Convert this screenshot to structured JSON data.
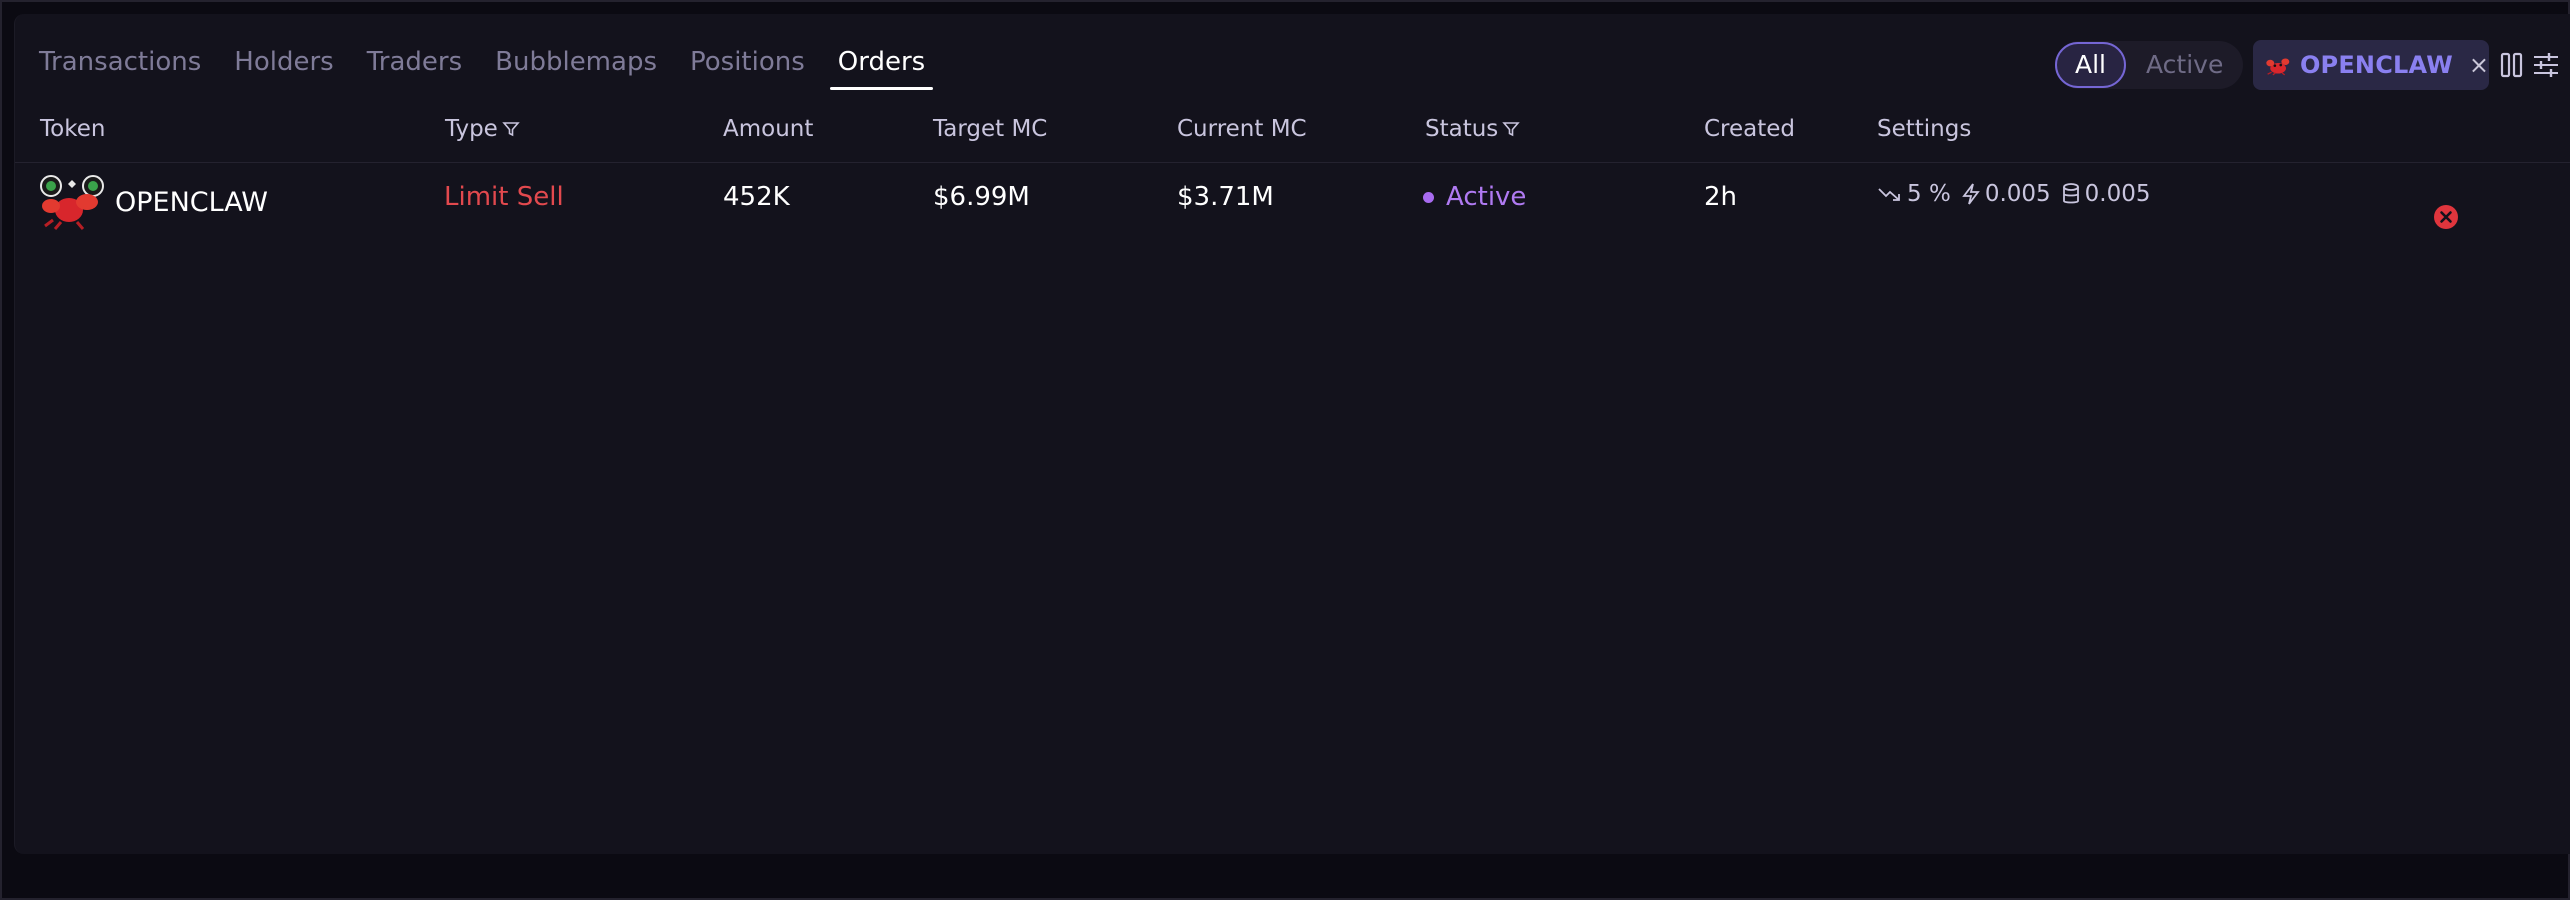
{
  "tabs": [
    {
      "label": "Transactions",
      "active": false
    },
    {
      "label": "Holders",
      "active": false
    },
    {
      "label": "Traders",
      "active": false
    },
    {
      "label": "Bubblemaps",
      "active": false
    },
    {
      "label": "Positions",
      "active": false
    },
    {
      "label": "Orders",
      "active": true
    }
  ],
  "filter": {
    "all_label": "All",
    "active_label": "Active",
    "selected": "All"
  },
  "token_filter": {
    "label": "OPENCLAW",
    "close_glyph": "×"
  },
  "columns": [
    "Token",
    "Type",
    "Amount",
    "Target MC",
    "Current MC",
    "Status",
    "Created",
    "Settings"
  ],
  "orders": [
    {
      "token": "OPENCLAW",
      "type": "Limit Sell",
      "amount": "452K",
      "target_mc": "$6.99M",
      "current_mc": "$3.71M",
      "status": "Active",
      "created": "2h",
      "settings": {
        "slippage": "5",
        "slippage_unit": "%",
        "priority_fee": "0.005",
        "bribe": "0.005"
      }
    }
  ],
  "icons": {
    "type_filter": "filter-icon",
    "status_filter": "filter-icon",
    "layout": "columns-icon",
    "settings": "sliders-icon",
    "slippage": "trend-down-icon",
    "priority": "lightning-icon",
    "bribe": "database-icon",
    "cancel": "close-circle-icon"
  },
  "colors": {
    "accent": "#7566d4",
    "sell_red": "#e2494e",
    "status_purple": "#b07af2",
    "cancel_red": "#e0353d"
  }
}
